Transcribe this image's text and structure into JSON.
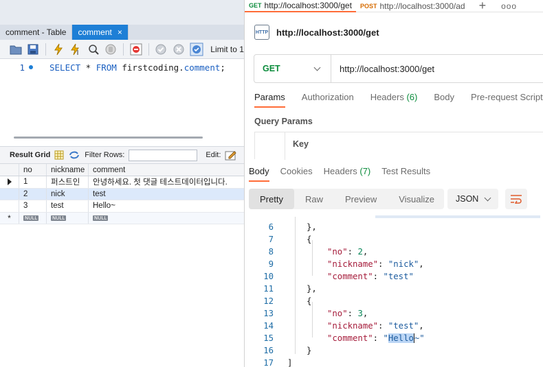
{
  "workbench": {
    "tabs": [
      {
        "label": "comment - Table",
        "active": false
      },
      {
        "label": "comment",
        "active": true,
        "close": "×"
      }
    ],
    "toolbar": {
      "limit_label": "Limit to 1"
    },
    "editor": {
      "line_number": "1",
      "sql_select": "SELECT",
      "sql_star": " * ",
      "sql_from": "FROM",
      "sql_schema": " firstcoding.",
      "sql_table": "comment",
      "sql_end": ";"
    },
    "result_bar": {
      "result_grid": "Result Grid",
      "filter_rows": "Filter Rows:",
      "edit": "Edit:"
    },
    "grid": {
      "headers": [
        "no",
        "nickname",
        "comment"
      ],
      "rows": [
        [
          "1",
          "퍼스트인",
          "안녕하세요. 첫 댓글 테스트데이터입니다."
        ],
        [
          "2",
          "nick",
          "test"
        ],
        [
          "3",
          "test",
          "Hello~"
        ]
      ],
      "null_label": "NULL",
      "new_row_marker": "*"
    }
  },
  "postman": {
    "tabs": [
      {
        "method": "GET",
        "url": "http://localhost:3000/get",
        "active": true
      },
      {
        "method": "POST",
        "url": "http://localhost:3000/ad",
        "active": false
      }
    ],
    "plus": "+",
    "more": "ooo",
    "request_title": "http://localhost:3000/get",
    "http_icon": "HTTP",
    "method": "GET",
    "url": "http://localhost:3000/get",
    "request_tabs": {
      "params": "Params",
      "authorization": "Authorization",
      "headers": "Headers",
      "headers_count": "(6)",
      "body": "Body",
      "prerequest": "Pre-request Script"
    },
    "query_params": "Query Params",
    "key_header": "Key",
    "response_tabs": {
      "body": "Body",
      "cookies": "Cookies",
      "headers": "Headers",
      "headers_count": "(7)",
      "test_results": "Test Results"
    },
    "views": [
      "Pretty",
      "Raw",
      "Preview",
      "Visualize"
    ],
    "format": "JSON",
    "code_lines": [
      {
        "n": "6",
        "text": "},"
      },
      {
        "n": "7",
        "text": "{"
      },
      {
        "n": "8",
        "key": "\"no\"",
        "value": "2",
        "vtype": "number"
      },
      {
        "n": "9",
        "key": "\"nickname\"",
        "value": "\"nick\"",
        "vtype": "string"
      },
      {
        "n": "10",
        "key": "\"comment\"",
        "value": "\"test\"",
        "vtype": "string"
      },
      {
        "n": "11",
        "text": "},"
      },
      {
        "n": "12",
        "text": "{"
      },
      {
        "n": "13",
        "key": "\"no\"",
        "value": "3",
        "vtype": "number"
      },
      {
        "n": "14",
        "key": "\"nickname\"",
        "value": "\"test\"",
        "vtype": "string"
      },
      {
        "n": "15",
        "key": "\"comment\"",
        "value_prefix": "\"",
        "value_selected": "Hello",
        "value_suffix": "~\"",
        "vtype": "string"
      },
      {
        "n": "16",
        "text": "}"
      },
      {
        "n": "17",
        "text": "]"
      }
    ]
  }
}
